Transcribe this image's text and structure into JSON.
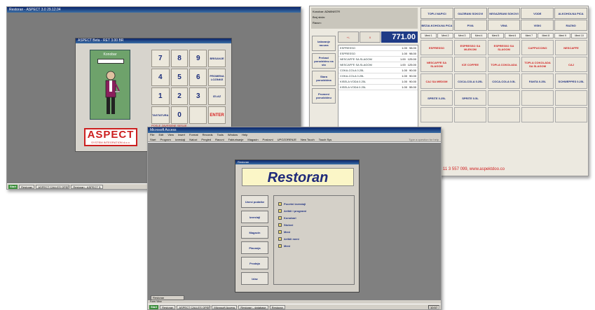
{
  "screen1": {
    "title": "Restoran - ASPECT 3.0 29.12.04",
    "dialog_title": "ASPECT Beta - RET 3.00 BR",
    "waiter_label": "Konobar",
    "keys": [
      "7",
      "8",
      "9",
      "BRISANJE",
      "4",
      "5",
      "6",
      "PROMENA LOZINKE",
      "1",
      "2",
      "3",
      "IZLAZ",
      "TASTATURA",
      "0",
      "",
      "ENTER"
    ],
    "notice": "POSLE ZAVRSENE SESIJE",
    "logo_big": "ASPECT",
    "logo_small": "SYSTEM INTEGRATION d.o.o.",
    "taskbar": {
      "start": "Start",
      "tasks": [
        "Restoran",
        "ASPECT CALLES OPERATIONAL",
        "Restoran - ASPECT 3."
      ],
      "tray": "10:56"
    }
  },
  "screen2": {
    "fields": [
      "Konobar:  ADMINISTR",
      "Broj stola:",
      "Racun:"
    ],
    "total": "771.00",
    "qty_buttons": [
      "+/-",
      "X"
    ],
    "side_buttons": [
      "Izdavanje racuna",
      "Prebaci porudzbinu na sto",
      "Stara porudzbina",
      "Promeni porudzbinu"
    ],
    "orders": [
      {
        "name": "ESPRESSO",
        "qty": "1.00",
        "price": "98.00"
      },
      {
        "name": "ESPRESSO",
        "qty": "1.00",
        "price": "98.00"
      },
      {
        "name": "NESCAFFE SA SLAGOM",
        "qty": "1.00",
        "price": "125.00"
      },
      {
        "name": "NESCAFFE SA SLAGOM",
        "qty": "1.00",
        "price": "125.00"
      },
      {
        "name": "COKA-COLA 0.25L",
        "qty": "1.00",
        "price": "90.00"
      },
      {
        "name": "COKA-COLA 0.25L",
        "qty": "1.00",
        "price": "90.00"
      },
      {
        "name": "KISELA VODA 0.25L",
        "qty": "1.00",
        "price": "90.00"
      },
      {
        "name": "KISELA VODA 0.25L",
        "qty": "1.00",
        "price": "55.00"
      }
    ],
    "categories": [
      "TOPLI NAPICI",
      "GAZIRANI SOKOVI",
      "NEGAZIRANI SOKOVI",
      "VODE",
      "ALKOHOLNA PICA",
      "BEZALKOHOLNA PICA",
      "PIVA",
      "VINA",
      "VISKI",
      "RAZNO"
    ],
    "tabs": [
      "Meni 1",
      "Meni 2",
      "Meni 3",
      "Meni 4",
      "Meni 5",
      "Meni 6",
      "Meni 7",
      "Meni 8",
      "Meni 9",
      "Meni 10"
    ],
    "items": [
      {
        "label": "ESPRESSO",
        "color": "red"
      },
      {
        "label": "ESPRESSO SA MLEKOM",
        "color": "red"
      },
      {
        "label": "ESPRESSO SA SLAGOM",
        "color": "red"
      },
      {
        "label": "CAPPUCCINO",
        "color": "red"
      },
      {
        "label": "NESCAFFE",
        "color": "red"
      },
      {
        "label": "NESCAFFE SA SLAGOM",
        "color": "red"
      },
      {
        "label": "ICE COFFEE",
        "color": "red"
      },
      {
        "label": "TOPLA COKOLADA",
        "color": "red"
      },
      {
        "label": "TOPLA COKOLADA SA SLAGOM",
        "color": "red"
      },
      {
        "label": "CAJ",
        "color": "red"
      },
      {
        "label": "CAJ SA MEDOM",
        "color": "red"
      },
      {
        "label": "COCA-COLA 0.25L",
        "color": "blue"
      },
      {
        "label": "COCA-COLA 0.5L",
        "color": "blue"
      },
      {
        "label": "FANTA 0.25L",
        "color": "blue"
      },
      {
        "label": "SCHWEPPES 0.25L",
        "color": "blue"
      },
      {
        "label": "SPRITE 0.25L",
        "color": "blue"
      },
      {
        "label": "SPRITE 0.5L",
        "color": "blue"
      },
      {
        "label": "",
        "color": "blue"
      },
      {
        "label": "",
        "color": "blue"
      },
      {
        "label": "",
        "color": "blue"
      },
      {
        "label": "",
        "color": "blue"
      },
      {
        "label": "",
        "color": "blue"
      },
      {
        "label": "",
        "color": "blue"
      },
      {
        "label": "",
        "color": "blue"
      },
      {
        "label": "",
        "color": "blue"
      }
    ],
    "footer": "11 3 557 099, www.aspektdoo.co"
  },
  "screen3": {
    "title": "Microsoft Access",
    "menu": [
      "File",
      "Edit",
      "View",
      "Insert",
      "Format",
      "Records",
      "Tools",
      "Window",
      "Help"
    ],
    "toolbar": [
      "Start",
      "Program",
      "Izvestaji",
      "Nalozi",
      "Pregled",
      "Racuni",
      "Fakturisanje",
      "Magacin",
      "Poslovni",
      "UPOZORENJE",
      "New Touch",
      "Touch Sys"
    ],
    "toolbar_right": "Type a question for help",
    "form_title": "Restoran",
    "banner": "Restoran",
    "buttons": [
      "Unesi podatke",
      "Izvestaji",
      "Magacin",
      "Placanja",
      "Prodaja",
      "Izlaz"
    ],
    "list": [
      "Pocetni izvestaji",
      "Artikli i programi",
      "Konobari",
      "Stolovi",
      "Meni",
      "Artikli meni",
      "Meni"
    ],
    "minwin": "Restoran",
    "status": "Form View",
    "taskbar": {
      "start": "Start",
      "tasks": [
        "Restoran",
        "ASPECT CALLES OPERATIONAL",
        "Microsoft Access",
        "Restoran - database",
        "Restoran"
      ],
      "tray": "10:57"
    }
  }
}
